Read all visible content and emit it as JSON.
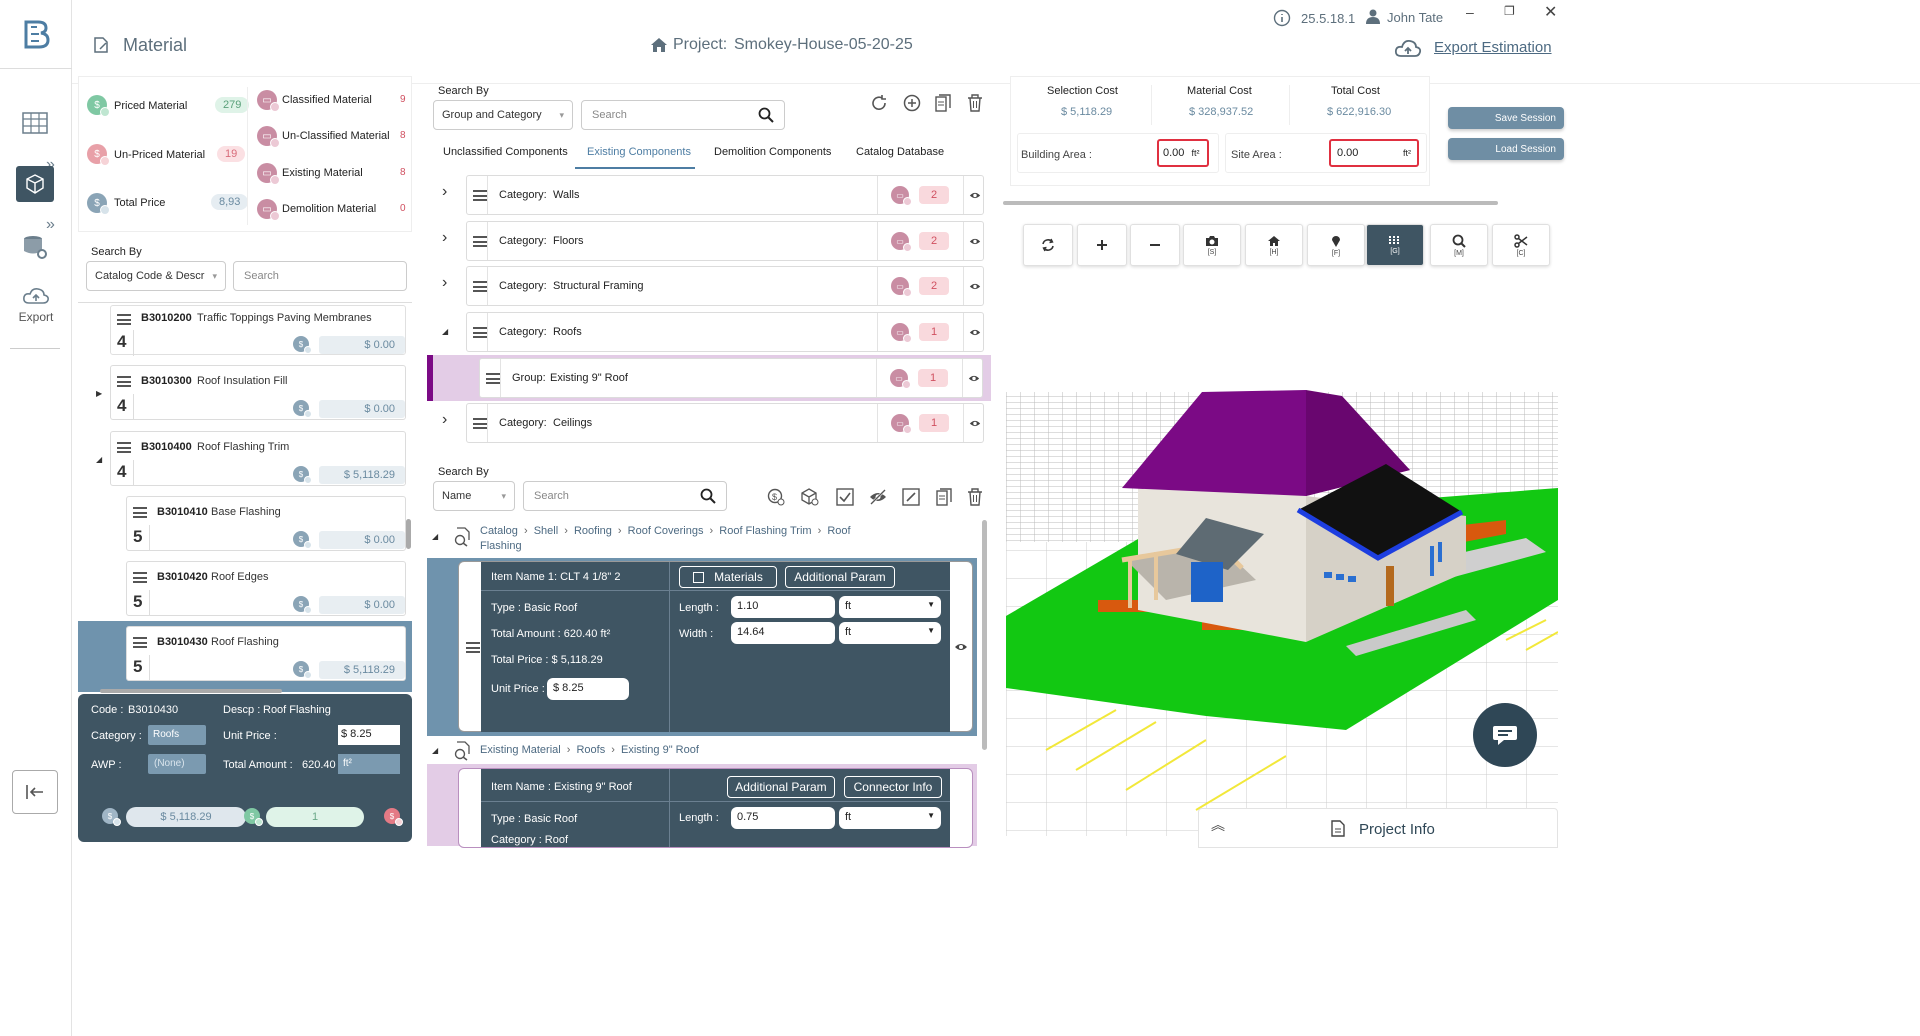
{
  "app": {
    "section_title": "Material",
    "project_label": "Project:",
    "project_name": "Smokey-House-05-20-25",
    "version": "25.5.18.1",
    "user": "John Tate",
    "export_label": "Export Estimation"
  },
  "nav": {
    "export_label": "Export"
  },
  "summary": {
    "priced_label": "Priced Material",
    "priced_count": "279",
    "unpriced_label": "Un-Priced Material",
    "unpriced_count": "19",
    "total_label": "Total Price",
    "total_value": "8,93",
    "classified_label": "Classified Material",
    "classified_count": "9",
    "unclassified_label": "Un-Classified Material",
    "unclassified_count": "8",
    "existing_label": "Existing Material",
    "existing_count": "8",
    "demolition_label": "Demolition Material",
    "demolition_count": "0"
  },
  "left_search": {
    "label": "Search By",
    "select_value": "Catalog Code & Descr",
    "placeholder": "Search"
  },
  "catalog_items": [
    {
      "code": "B3010200",
      "desc": "Traffic Toppings Paving Membranes",
      "level": "4",
      "price": "$ 0.00"
    },
    {
      "code": "B3010300",
      "desc": "Roof Insulation Fill",
      "level": "4",
      "price": "$ 0.00"
    },
    {
      "code": "B3010400",
      "desc": "Roof Flashing Trim",
      "level": "4",
      "price": "$ 5,118.29"
    },
    {
      "code": "B3010410",
      "desc": "Base Flashing",
      "level": "5",
      "price": "$ 0.00"
    },
    {
      "code": "B3010420",
      "desc": "Roof Edges",
      "level": "5",
      "price": "$ 0.00"
    },
    {
      "code": "B3010430",
      "desc": "Roof Flashing",
      "level": "5",
      "price": "$ 5,118.29"
    }
  ],
  "detail": {
    "code_label": "Code :",
    "code_value": "B3010430",
    "descp_label": "Descp :",
    "descp_value": "Roof Flashing",
    "category_label": "Category :",
    "category_value": "Roofs",
    "unit_price_label": "Unit Price :",
    "unit_price_value": "$ 8.25",
    "awp_label": "AWP :",
    "awp_value": "(None)",
    "total_amount_label": "Total Amount :",
    "total_amount_value": "620.40",
    "total_amount_unit": "ft²",
    "footer_price": "$ 5,118.29",
    "footer_count": "1"
  },
  "mid_search": {
    "label": "Search By",
    "select_value": "Group and Category",
    "placeholder": "Search"
  },
  "tabs": [
    "Unclassified Components",
    "Existing Components",
    "Demolition Components",
    "Catalog Database"
  ],
  "active_tab": "Existing Components",
  "categories": [
    {
      "label": "Category:",
      "name": "Walls",
      "count": "2"
    },
    {
      "label": "Category:",
      "name": "Floors",
      "count": "2"
    },
    {
      "label": "Category:",
      "name": "Structural Framing",
      "count": "2"
    },
    {
      "label": "Category:",
      "name": "Roofs",
      "count": "1"
    },
    {
      "label": "Group:",
      "name": "Existing 9\" Roof",
      "count": "1"
    },
    {
      "label": "Category:",
      "name": "Ceilings",
      "count": "1"
    }
  ],
  "lower_search": {
    "label": "Search By",
    "select_value": "Name",
    "placeholder": "Search"
  },
  "breadcrumb1": [
    "Catalog",
    "Shell",
    "Roofing",
    "Roof Coverings",
    "Roof Flashing Trim",
    "Roof Flashing"
  ],
  "breadcrumb2": [
    "Existing Material",
    "Roofs",
    "Existing 9\" Roof"
  ],
  "item1": {
    "name": "Item Name 1: CLT 4 1/8\" 2",
    "materials_btn": "Materials",
    "additional_btn": "Additional Param",
    "type": "Type :  Basic Roof",
    "total_amount": "Total Amount :  620.40 ft²",
    "total_price": "Total Price : $ 5,118.29",
    "unit_price_label": "Unit Price :",
    "unit_price_value": "$ 8.25",
    "length_label": "Length :",
    "length_value": "1.10",
    "length_unit": "ft",
    "width_label": "Width :",
    "width_value": "14.64",
    "width_unit": "ft"
  },
  "item2": {
    "name": "Item Name : Existing 9\" Roof",
    "additional_btn": "Additional Param",
    "connector_btn": "Connector Info",
    "type": "Type :  Basic Roof",
    "category": "Category :  Roof",
    "length_label": "Length :",
    "length_value": "0.75",
    "length_unit": "ft"
  },
  "costs": {
    "selection_label": "Selection Cost",
    "selection_value": "$ 5,118.29",
    "material_label": "Material Cost",
    "material_value": "$ 328,937.52",
    "total_label": "Total Cost",
    "total_value": "$ 622,916.30",
    "building_area_label": "Building Area :",
    "building_area_value": "0.00",
    "site_area_label": "Site Area :",
    "site_area_value": "0.00",
    "area_unit": "ft²",
    "save_btn": "Save Session",
    "load_btn": "Load Session"
  },
  "toolbar": [
    {
      "key": "",
      "name": "refresh"
    },
    {
      "key": "",
      "name": "zoom-in"
    },
    {
      "key": "",
      "name": "zoom-out"
    },
    {
      "key": "[S]",
      "name": "camera"
    },
    {
      "key": "[H]",
      "name": "home"
    },
    {
      "key": "[F]",
      "name": "pin"
    },
    {
      "key": "[G]",
      "name": "grid"
    },
    {
      "key": "[M]",
      "name": "measure"
    },
    {
      "key": "[C]",
      "name": "cut"
    }
  ],
  "project_info_label": "Project Info",
  "colors": {
    "accent": "#3f5563",
    "roof": "#7b0a85",
    "ground": "#12c812",
    "wall": "#e8e4dc"
  }
}
